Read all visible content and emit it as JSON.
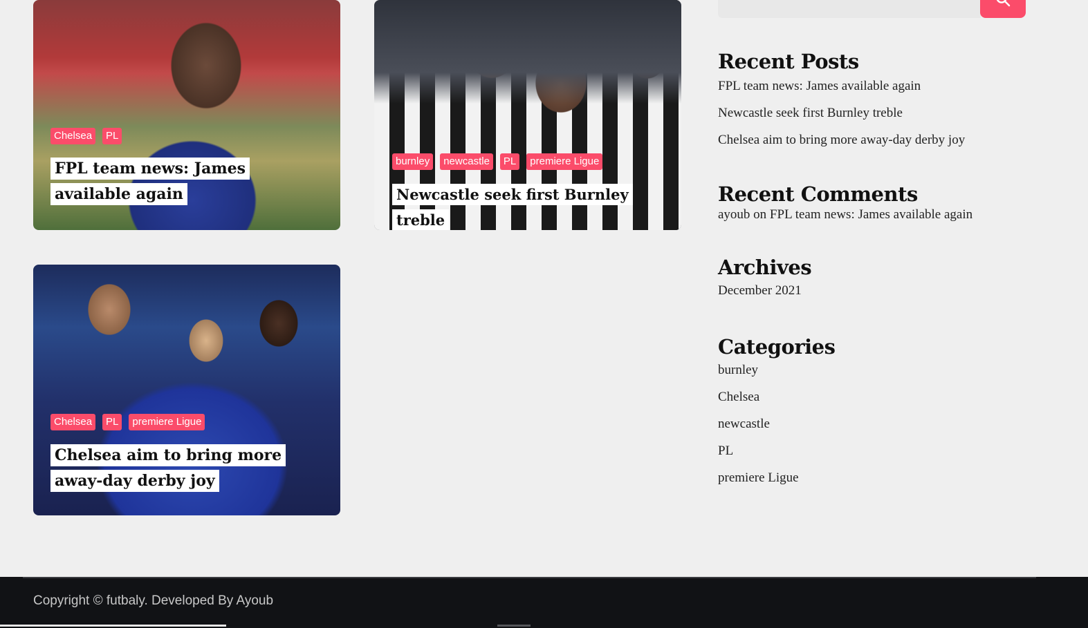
{
  "colors": {
    "accent": "#fb4c6a",
    "footer_bg": "#111215",
    "page_bg": "#efefef"
  },
  "search": {
    "icon": "search-icon"
  },
  "posts": [
    {
      "tags": [
        "Chelsea",
        "PL"
      ],
      "title": "FPL team news: James available again"
    },
    {
      "tags": [
        "burnley",
        "newcastle",
        "PL",
        "premiere Ligue"
      ],
      "title": "Newcastle seek first Burnley treble"
    },
    {
      "tags": [
        "Chelsea",
        "PL",
        "premiere Ligue"
      ],
      "title": "Chelsea aim to bring more away-day derby joy"
    }
  ],
  "sidebar": {
    "recent_posts": {
      "heading": "Recent Posts",
      "items": [
        "FPL team news: James available again",
        "Newcastle seek first Burnley treble",
        "Chelsea aim to bring more away-day derby joy"
      ]
    },
    "recent_comments": {
      "heading": "Recent Comments",
      "items": [
        "ayoub on FPL team news: James available again"
      ]
    },
    "archives": {
      "heading": "Archives",
      "items": [
        "December 2021"
      ]
    },
    "categories": {
      "heading": "Categories",
      "items": [
        "burnley",
        "Chelsea",
        "newcastle",
        "PL",
        "premiere Ligue"
      ]
    }
  },
  "footer": {
    "copyright": "Copyright © futbaly. Developed By Ayoub"
  }
}
